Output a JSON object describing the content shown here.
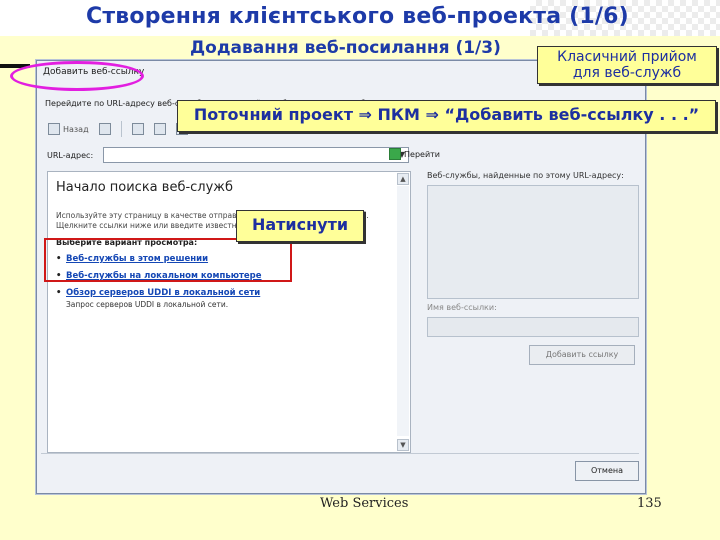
{
  "slide": {
    "title": "Створення клієнтського веб-проекта   (1/6)",
    "subtitle": "Додавання веб-посилання (1/3)",
    "callout_classic": "Класичний прийом\nдля веб-служб",
    "callout_path": "Поточний проект ⇒ ПКМ ⇒ “Добавить веб-ссылку . . .”",
    "callout_click": "Натиснути",
    "footer_center": "Web Services",
    "footer_page": "135"
  },
  "dialog": {
    "title": "Добавить веб-ссылку",
    "hint": "Перейдите по URL-адресу веб-службы, найдите её и выберите нужную веб-ссылку.",
    "toolbar": {
      "back_label": "Назад"
    },
    "url_label": "URL-адрес:",
    "url_value": "",
    "go_label": "Перейти",
    "content": {
      "heading": "Начало поиска веб-служб",
      "intro_line1": "Используйте эту страницу в качестве отправной точки для поиска веб-служб.",
      "intro_line2": "Щелкните ссылки ниже или введите известный URL-адрес.",
      "choose_label": "Выберите вариант просмотра:",
      "options": [
        {
          "label": "Веб-службы в этом решении"
        },
        {
          "label": "Веб-службы на локальном компьютере"
        },
        {
          "label": "Обзор серверов UDDI в локальной сети",
          "desc": "Запрос серверов UDDI в локальной сети."
        }
      ]
    },
    "results_label": "Веб-службы, найденные по этому URL-адресу:",
    "name_label": "Имя веб-ссылки:",
    "add_button": "Добавить ссылку",
    "cancel_button": "Отмена"
  }
}
